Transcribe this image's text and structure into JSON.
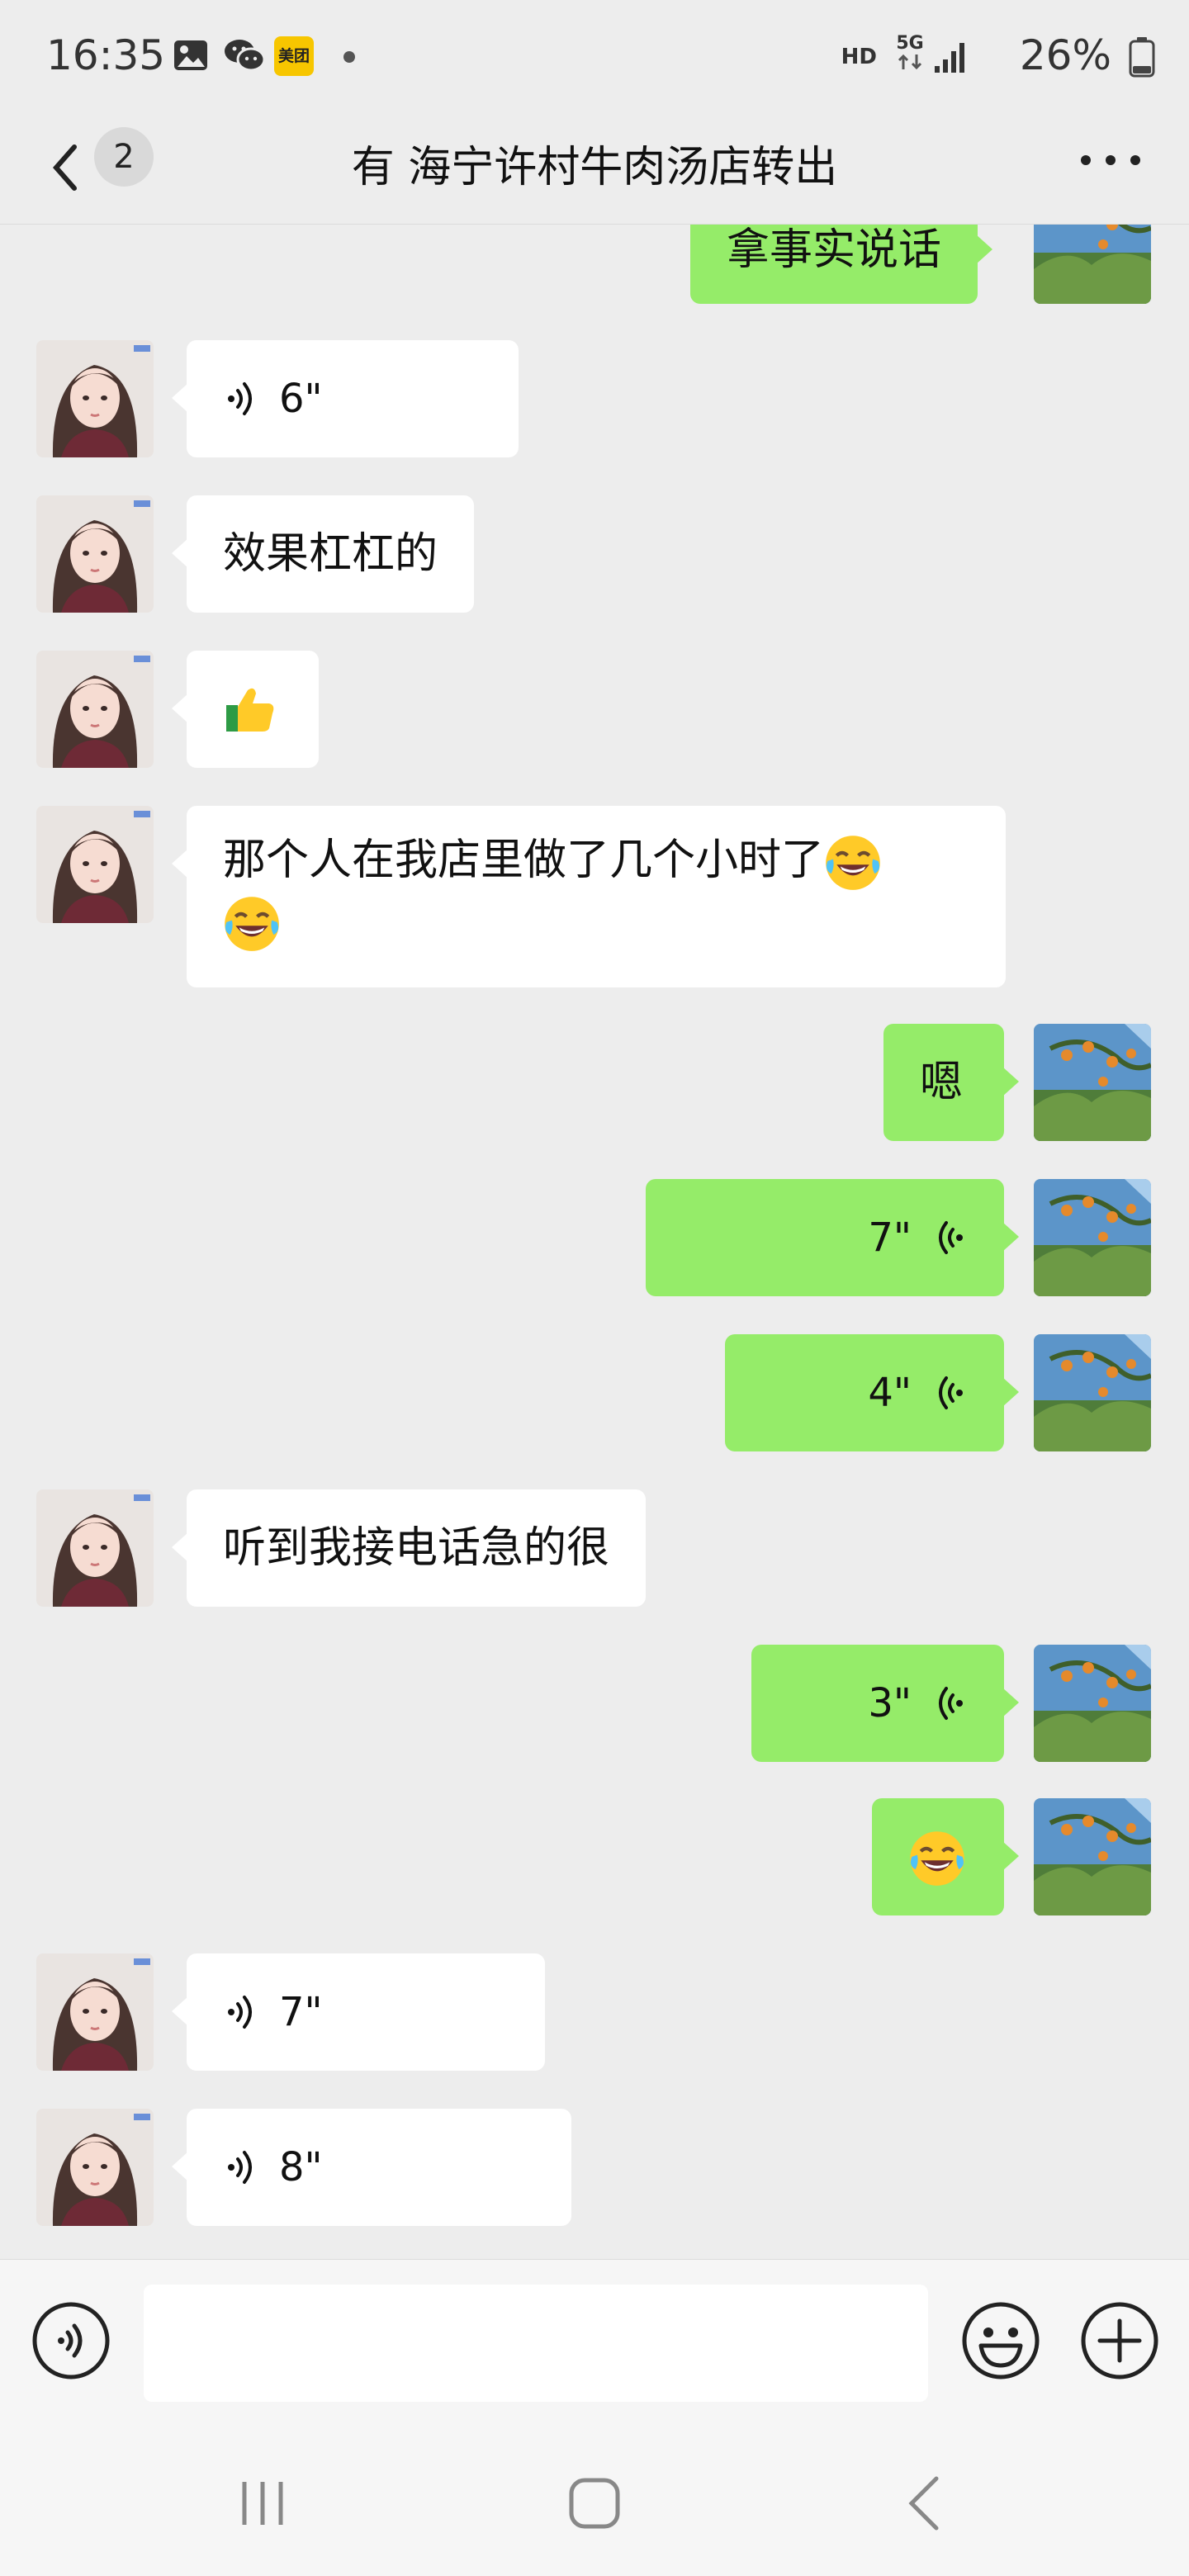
{
  "status_bar": {
    "time": "16:35",
    "app_badge": "美团",
    "network_hd": "HD",
    "network_5g": "5G",
    "battery_percent": "26%"
  },
  "header": {
    "unread_count": "2",
    "title": "有 海宁许村牛肉汤店转出"
  },
  "messages": [
    {
      "side": "out",
      "type": "text",
      "text": "拿事实说话"
    },
    {
      "side": "in",
      "type": "voice",
      "duration": "6\""
    },
    {
      "side": "in",
      "type": "text",
      "text": "效果杠杠的"
    },
    {
      "side": "in",
      "type": "emoji",
      "emoji": "thumbs-up"
    },
    {
      "side": "in",
      "type": "text",
      "text": "那个人在我店里做了几个小时了"
    },
    {
      "side": "out",
      "type": "text",
      "text": "嗯"
    },
    {
      "side": "out",
      "type": "voice",
      "duration": "7\""
    },
    {
      "side": "out",
      "type": "voice",
      "duration": "4\""
    },
    {
      "side": "in",
      "type": "text",
      "text": "听到我接电话急的很"
    },
    {
      "side": "out",
      "type": "voice",
      "duration": "3\""
    },
    {
      "side": "out",
      "type": "emoji",
      "emoji": "rolling-laughing"
    },
    {
      "side": "in",
      "type": "voice",
      "duration": "7\""
    },
    {
      "side": "in",
      "type": "voice",
      "duration": "8\""
    }
  ],
  "colors": {
    "background": "#ededed",
    "outgoing_bubble": "#95ec69",
    "incoming_bubble": "#ffffff"
  }
}
